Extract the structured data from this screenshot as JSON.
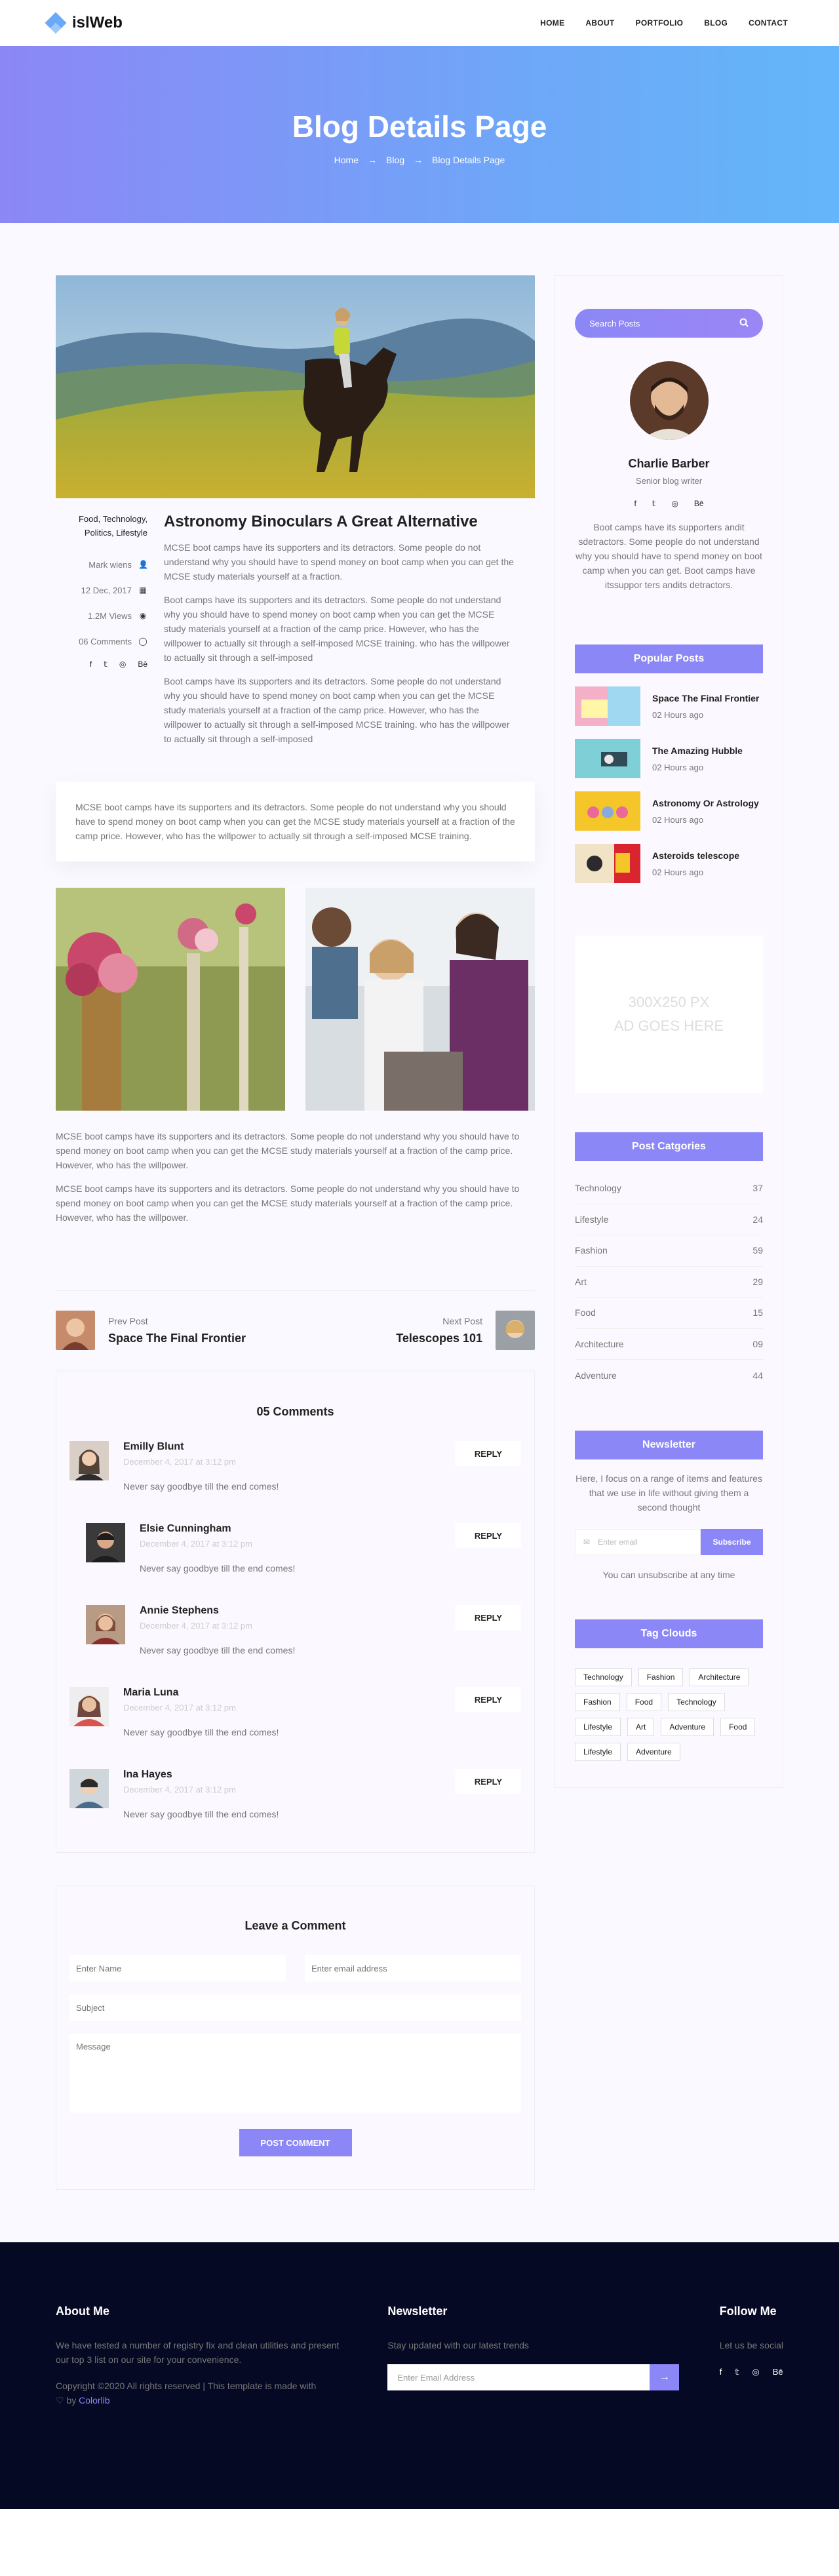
{
  "header": {
    "logo": "islWeb",
    "nav": [
      "HOME",
      "ABOUT",
      "PORTFOLIO",
      "BLOG",
      "CONTACT"
    ]
  },
  "hero": {
    "title": "Blog Details Page",
    "crumbs": [
      "Home",
      "Blog",
      "Blog Details Page"
    ]
  },
  "post": {
    "tags": "Food, Technology, Politics, Lifestyle",
    "author": "Mark wiens",
    "date": "12 Dec, 2017",
    "views": "1.2M Views",
    "comments": "06 Comments",
    "title": "Astronomy Binoculars A Great Alternative",
    "paragraphs": [
      "MCSE boot camps have its supporters and its detractors. Some people do not understand why you should have to spend money on boot camp when you can get the MCSE study materials yourself at a fraction.",
      "Boot camps have its supporters and its detractors. Some people do not understand why you should have to spend money on boot camp when you can get the MCSE study materials yourself at a fraction of the camp price. However, who has the willpower to actually sit through a self-imposed MCSE training. who has the willpower to actually sit through a self-imposed",
      "Boot camps have its supporters and its detractors. Some people do not understand why you should have to spend money on boot camp when you can get the MCSE study materials yourself at a fraction of the camp price. However, who has the willpower to actually sit through a self-imposed MCSE training. who has the willpower to actually sit through a self-imposed"
    ],
    "quote": "MCSE boot camps have its supporters and its detractors. Some people do not understand why you should have to spend money on boot camp when you can get the MCSE study materials yourself at a fraction of the camp price. However, who has the willpower to actually sit through a self-imposed MCSE training.",
    "after": [
      "MCSE boot camps have its supporters and its detractors. Some people do not understand why you should have to spend money on boot camp when you can get the MCSE study materials yourself at a fraction of the camp price. However, who has the willpower.",
      "MCSE boot camps have its supporters and its detractors. Some people do not understand why you should have to spend money on boot camp when you can get the MCSE study materials yourself at a fraction of the camp price. However, who has the willpower."
    ]
  },
  "post_nav": {
    "prev_label": "Prev Post",
    "prev_title": "Space The Final Frontier",
    "next_label": "Next Post",
    "next_title": "Telescopes 101"
  },
  "comments": {
    "title": "05 Comments",
    "reply_label": "REPLY",
    "items": [
      {
        "name": "Emilly Blunt",
        "date": "December 4, 2017 at 3:12 pm",
        "text": "Never say goodbye till the end comes!"
      },
      {
        "name": "Elsie Cunningham",
        "date": "December 4, 2017 at 3:12 pm",
        "text": "Never say goodbye till the end comes!"
      },
      {
        "name": "Annie Stephens",
        "date": "December 4, 2017 at 3:12 pm",
        "text": "Never say goodbye till the end comes!"
      },
      {
        "name": "Maria Luna",
        "date": "December 4, 2017 at 3:12 pm",
        "text": "Never say goodbye till the end comes!"
      },
      {
        "name": "Ina Hayes",
        "date": "December 4, 2017 at 3:12 pm",
        "text": "Never say goodbye till the end comes!"
      }
    ]
  },
  "form": {
    "title": "Leave a Comment",
    "name_placeholder": "Enter Name",
    "email_placeholder": "Enter email address",
    "subject_placeholder": "Subject",
    "message_placeholder": "Message",
    "submit": "POST COMMENT"
  },
  "sidebar": {
    "search_placeholder": "Search Posts",
    "author": {
      "name": "Charlie Barber",
      "role": "Senior blog writer",
      "bio": "Boot camps have its supporters andit sdetractors. Some people do not understand why you should have to spend money on boot camp when you can get. Boot camps have itssuppor ters andits detractors."
    },
    "popular_title": "Popular Posts",
    "popular": [
      {
        "title": "Space The Final Frontier",
        "time": "02 Hours ago"
      },
      {
        "title": "The Amazing Hubble",
        "time": "02 Hours ago"
      },
      {
        "title": "Astronomy Or Astrology",
        "time": "02 Hours ago"
      },
      {
        "title": "Asteroids telescope",
        "time": "02 Hours ago"
      }
    ],
    "ad": [
      "300X250 PX",
      "AD GOES HERE"
    ],
    "cat_title": "Post Catgories",
    "categories": [
      {
        "name": "Technology",
        "count": "37"
      },
      {
        "name": "Lifestyle",
        "count": "24"
      },
      {
        "name": "Fashion",
        "count": "59"
      },
      {
        "name": "Art",
        "count": "29"
      },
      {
        "name": "Food",
        "count": "15"
      },
      {
        "name": "Architecture",
        "count": "09"
      },
      {
        "name": "Adventure",
        "count": "44"
      }
    ],
    "nl_title": "Newsletter",
    "nl_text": "Here, I focus on a range of items and features that we use in life without giving them a second thought",
    "nl_placeholder": "Enter email",
    "nl_button": "Subscribe",
    "nl_note": "You can unsubscribe at any time",
    "tag_title": "Tag Clouds",
    "tags": [
      "Technology",
      "Fashion",
      "Architecture",
      "Fashion",
      "Food",
      "Technology",
      "Lifestyle",
      "Art",
      "Adventure",
      "Food",
      "Lifestyle",
      "Adventure"
    ]
  },
  "footer": {
    "about_title": "About Me",
    "about_text": "We have tested a number of registry fix and clean utilities and present our top 3 list on our site for your convenience.",
    "copyright": "Copyright ©2020 All rights reserved | This template is made with",
    "by": "by",
    "brand": "Colorlib",
    "nl_title": "Newsletter",
    "nl_text": "Stay updated with our latest trends",
    "nl_placeholder": "Enter Email Address",
    "follow_title": "Follow Me",
    "follow_text": "Let us be social"
  }
}
